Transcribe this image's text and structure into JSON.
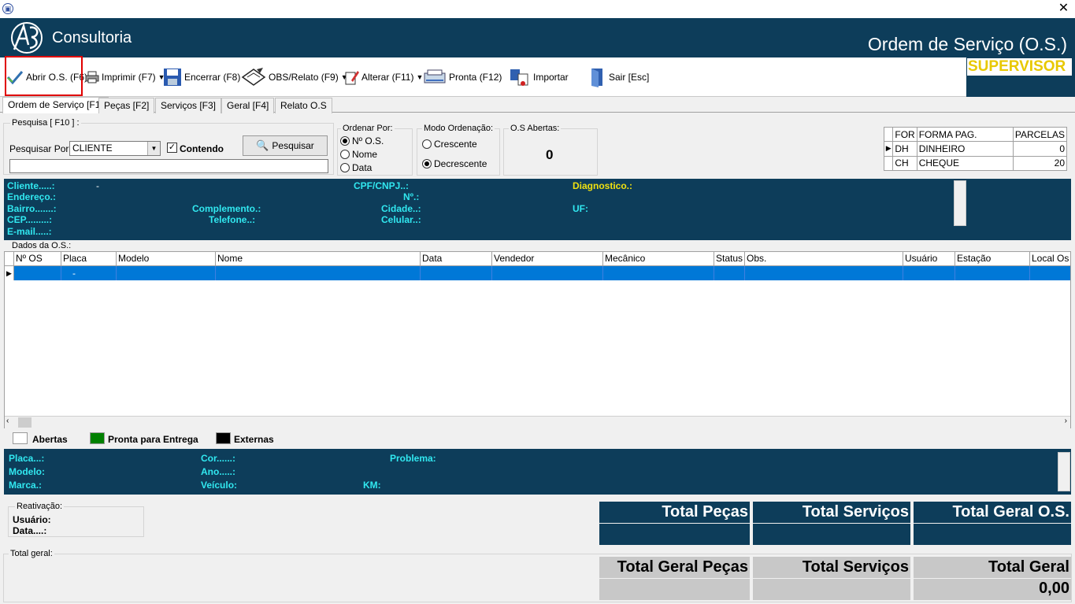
{
  "window": {
    "close": "✕"
  },
  "header": {
    "logo_text": "Consultoria",
    "title": "Ordem de Serviço (O.S.)"
  },
  "toolbar": {
    "abrir": "Abrir O.S. (F6)",
    "imprimir": "Imprimir  (F7)",
    "encerrar": "Encerrar (F8)",
    "obs": "OBS/Relato (F9)",
    "alterar": "Alterar (F11)",
    "pronta": "Pronta (F12)",
    "importar": "Importar",
    "sair": "Sair [Esc]",
    "supervisor": "SUPERVISOR"
  },
  "tabs": [
    "Ordem de Serviço [F1]",
    "Peças [F2]",
    "Serviços [F3]",
    "Geral [F4]",
    "Relato O.S"
  ],
  "search": {
    "legend": "Pesquisa [ F10 ] :",
    "by_label": "Pesquisar Por:",
    "by_value": "CLIENTE",
    "contendo": "Contendo",
    "button": "Pesquisar",
    "text_value": ""
  },
  "order": {
    "legend": "Ordenar Por:",
    "options": [
      "Nº O.S.",
      "Nome",
      "Data"
    ],
    "selected": 0
  },
  "mode": {
    "legend": "Modo Ordenação:",
    "options": [
      "Crescente",
      "Decrescente"
    ],
    "selected": 1
  },
  "open_os": {
    "legend": "O.S Abertas:",
    "count": "0"
  },
  "payments": {
    "headers": [
      "FOR",
      "FORMA PAG.",
      "PARCELAS"
    ],
    "rows": [
      {
        "code": "DH",
        "name": "DINHEIRO",
        "parcelas": "0"
      },
      {
        "code": "CH",
        "name": "CHEQUE",
        "parcelas": "20"
      }
    ]
  },
  "client": {
    "cliente": "Cliente.....:",
    "cliente_value": "-",
    "endereco": "Endereço.:",
    "bairro": "Bairro.......:",
    "cep": "CEP.........:",
    "email": "E-mail.....:",
    "cpf": "CPF/CNPJ..:",
    "numero": "Nº.:",
    "complemento": "Complemento.:",
    "cidade": "Cidade..:",
    "telefone": "Telefone..:",
    "celular": "Celular..:",
    "diagnostico": "Diagnostico.:",
    "uf": "UF:"
  },
  "grid": {
    "legend": "Dados da O.S.:",
    "columns": [
      "Nº OS",
      "Placa",
      "Modelo",
      "Nome",
      "Data",
      "Vendedor",
      "Mecânico",
      "Status",
      "Obs.",
      "Usuário",
      "Estação",
      "Local Os"
    ],
    "row_placa": "-"
  },
  "legend_keys": {
    "abertas": "Abertas",
    "abertas_color": "#ffffff",
    "pronta": "Pronta para Entrega",
    "pronta_color": "#008000",
    "externas": "Externas",
    "externas_color": "#000000"
  },
  "vehicle": {
    "placa": "Placa...:",
    "modelo": "Modelo:",
    "marca": "Marca.:",
    "cor": "Cor......:",
    "ano": "Ano.....:",
    "veiculo": "Veículo:",
    "problema": "Problema:",
    "km": "KM:"
  },
  "reativacao": {
    "legend": "Reativação:",
    "usuario": "Usuário:",
    "data": "Data....:"
  },
  "totals": {
    "pecas": "Total Peças",
    "servicos": "Total Serviços",
    "geral_os": "Total Geral O.S."
  },
  "total_geral": {
    "legend": "Total geral:",
    "pecas": "Total Geral Peças",
    "servicos": "Total Serviços",
    "geral": "Total Geral",
    "geral_value": "0,00"
  },
  "colors": {
    "navy": "#0d3d5a",
    "cyan_label": "#31e8f0",
    "yellow_label": "#f0e010",
    "selected_row": "#0078d7"
  }
}
